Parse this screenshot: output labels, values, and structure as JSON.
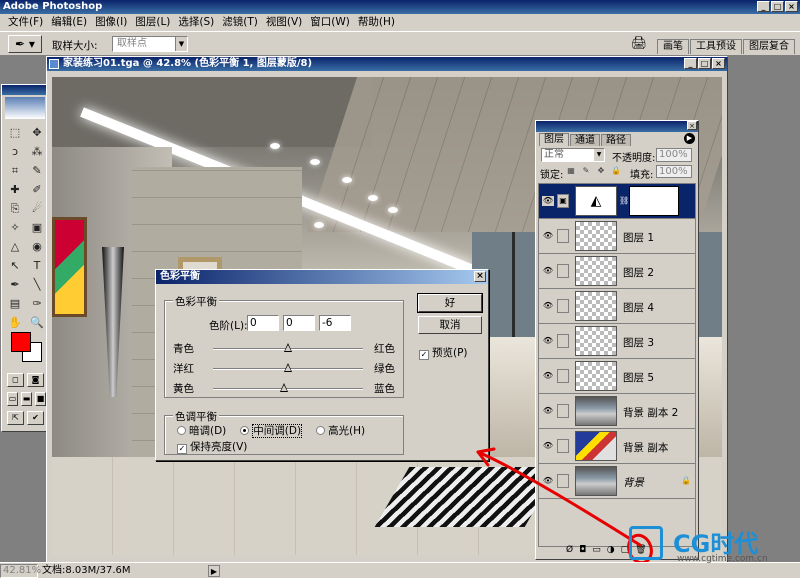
{
  "app": {
    "title": "Adobe Photoshop",
    "win_buttons": [
      "_",
      "□",
      "×"
    ]
  },
  "menu": [
    "文件(F)",
    "编辑(E)",
    "图像(I)",
    "图层(L)",
    "选择(S)",
    "滤镜(T)",
    "视图(V)",
    "窗口(W)",
    "帮助(H)"
  ],
  "options": {
    "sample_label": "取样大小:",
    "sample_value": "取样点",
    "palette_tabs": [
      "画笔",
      "工具预设",
      "图层复合"
    ]
  },
  "document": {
    "title": "家装练习01.tga @ 42.8% (色彩平衡 1, 图层蒙版/8)",
    "buttons": [
      "_",
      "□",
      "×"
    ]
  },
  "toolbox": {
    "tools": [
      "⬚",
      "✥",
      "ↄ",
      "⁂",
      "⌗",
      "✎",
      "✚",
      "✐",
      "⎘",
      "☄",
      "✧",
      "▣",
      "△",
      "◉",
      "↖",
      "T",
      "✒",
      "╲",
      "▤",
      "✑",
      "✋",
      "🔍"
    ],
    "foreground_color": "#ff0000",
    "background_color": "#ffffff"
  },
  "dialog": {
    "title": "色彩平衡",
    "color_balance_group": "色彩平衡",
    "levels_label": "色阶(L):",
    "levels": [
      "0",
      "0",
      "-6"
    ],
    "sliders": [
      {
        "left": "青色",
        "right": "红色",
        "value": 0
      },
      {
        "left": "洋红",
        "right": "绿色",
        "value": 0
      },
      {
        "left": "黄色",
        "right": "蓝色",
        "value": -6
      }
    ],
    "tone_group": "色调平衡",
    "tones": [
      {
        "label": "暗调(D)",
        "selected": false
      },
      {
        "label": "中间调(D)",
        "selected": true
      },
      {
        "label": "高光(H)",
        "selected": false
      }
    ],
    "preserve_luminosity": "保持亮度(V)",
    "ok": "好",
    "cancel": "取消",
    "preview": "预览(P)"
  },
  "layers": {
    "tabs": [
      "图层",
      "通道",
      "路径"
    ],
    "blend_mode": "正常",
    "opacity_label": "不透明度:",
    "opacity": "100%",
    "lock_label": "锁定:",
    "fill_label": "填充:",
    "fill": "100%",
    "items": [
      {
        "name": "",
        "type": "adjustment",
        "active": true
      },
      {
        "name": "图层 1",
        "type": "transparent"
      },
      {
        "name": "图层 2",
        "type": "transparent"
      },
      {
        "name": "图层 4",
        "type": "transparent"
      },
      {
        "name": "图层 3",
        "type": "transparent"
      },
      {
        "name": "图层 5",
        "type": "transparent"
      },
      {
        "name": "背景 副本 2",
        "type": "photo"
      },
      {
        "name": "背景 副本",
        "type": "photo2"
      },
      {
        "name": "背景",
        "type": "photo",
        "italic": true,
        "locked": true
      }
    ]
  },
  "status": {
    "zoom": "42.81%",
    "doc_size": "文档:8.03M/37.6M"
  },
  "watermark": {
    "brand": "CG时代",
    "url": "www.cgtime.com.cn"
  },
  "colors": {
    "title_bar": "#0a246a",
    "chrome": "#d4d0c8",
    "annotation": "#e60000",
    "watermark": "#1d8fd6"
  }
}
